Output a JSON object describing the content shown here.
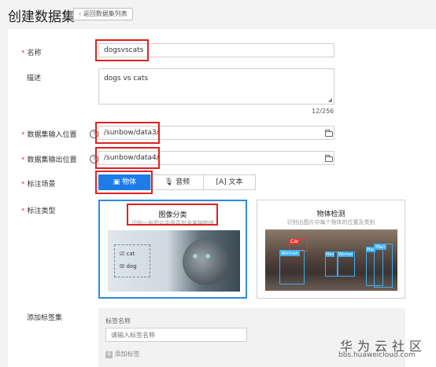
{
  "header": {
    "title": "创建数据集",
    "back_label": "返回数据集列表"
  },
  "form": {
    "name": {
      "label": "名称",
      "value": "dogsvscats"
    },
    "description": {
      "label": "描述",
      "value": "dogs vs cats",
      "counter": "12/256"
    },
    "input_location": {
      "label": "数据集输入位置",
      "value": "/sunbow/data3/"
    },
    "output_location": {
      "label": "数据集输出位置",
      "value": "/sunbow/data4/"
    },
    "scene": {
      "label": "标注场景",
      "options": [
        {
          "label": "物体",
          "icon": "image-icon",
          "active": true
        },
        {
          "label": "音频",
          "icon": "microphone-icon",
          "active": false
        },
        {
          "label": "文本",
          "icon": "text-icon",
          "active": false
        }
      ]
    },
    "type": {
      "label": "标注类型",
      "cards": [
        {
          "title": "图像分类",
          "desc": "识别一张图片中是否包含某种物体",
          "selected": true,
          "example_labels": [
            "cat",
            "dog"
          ]
        },
        {
          "title": "物体检测",
          "desc": "识别出图片中每个物体的位置及类别",
          "selected": false,
          "example_labels": [
            "Car",
            "Women",
            "Man",
            "Woman",
            "Man",
            "Man"
          ]
        }
      ]
    },
    "label_set": {
      "label": "添加标签集",
      "name_label": "标签名称",
      "placeholder": "请输入标签名称",
      "add_label": "添加标签"
    }
  },
  "watermark": {
    "cn": "华为云社区",
    "en": "bbs.huaweicloud.com"
  },
  "colors": {
    "accent": "#1e7ce8",
    "required": "#e64545",
    "highlight": "#e02020"
  }
}
